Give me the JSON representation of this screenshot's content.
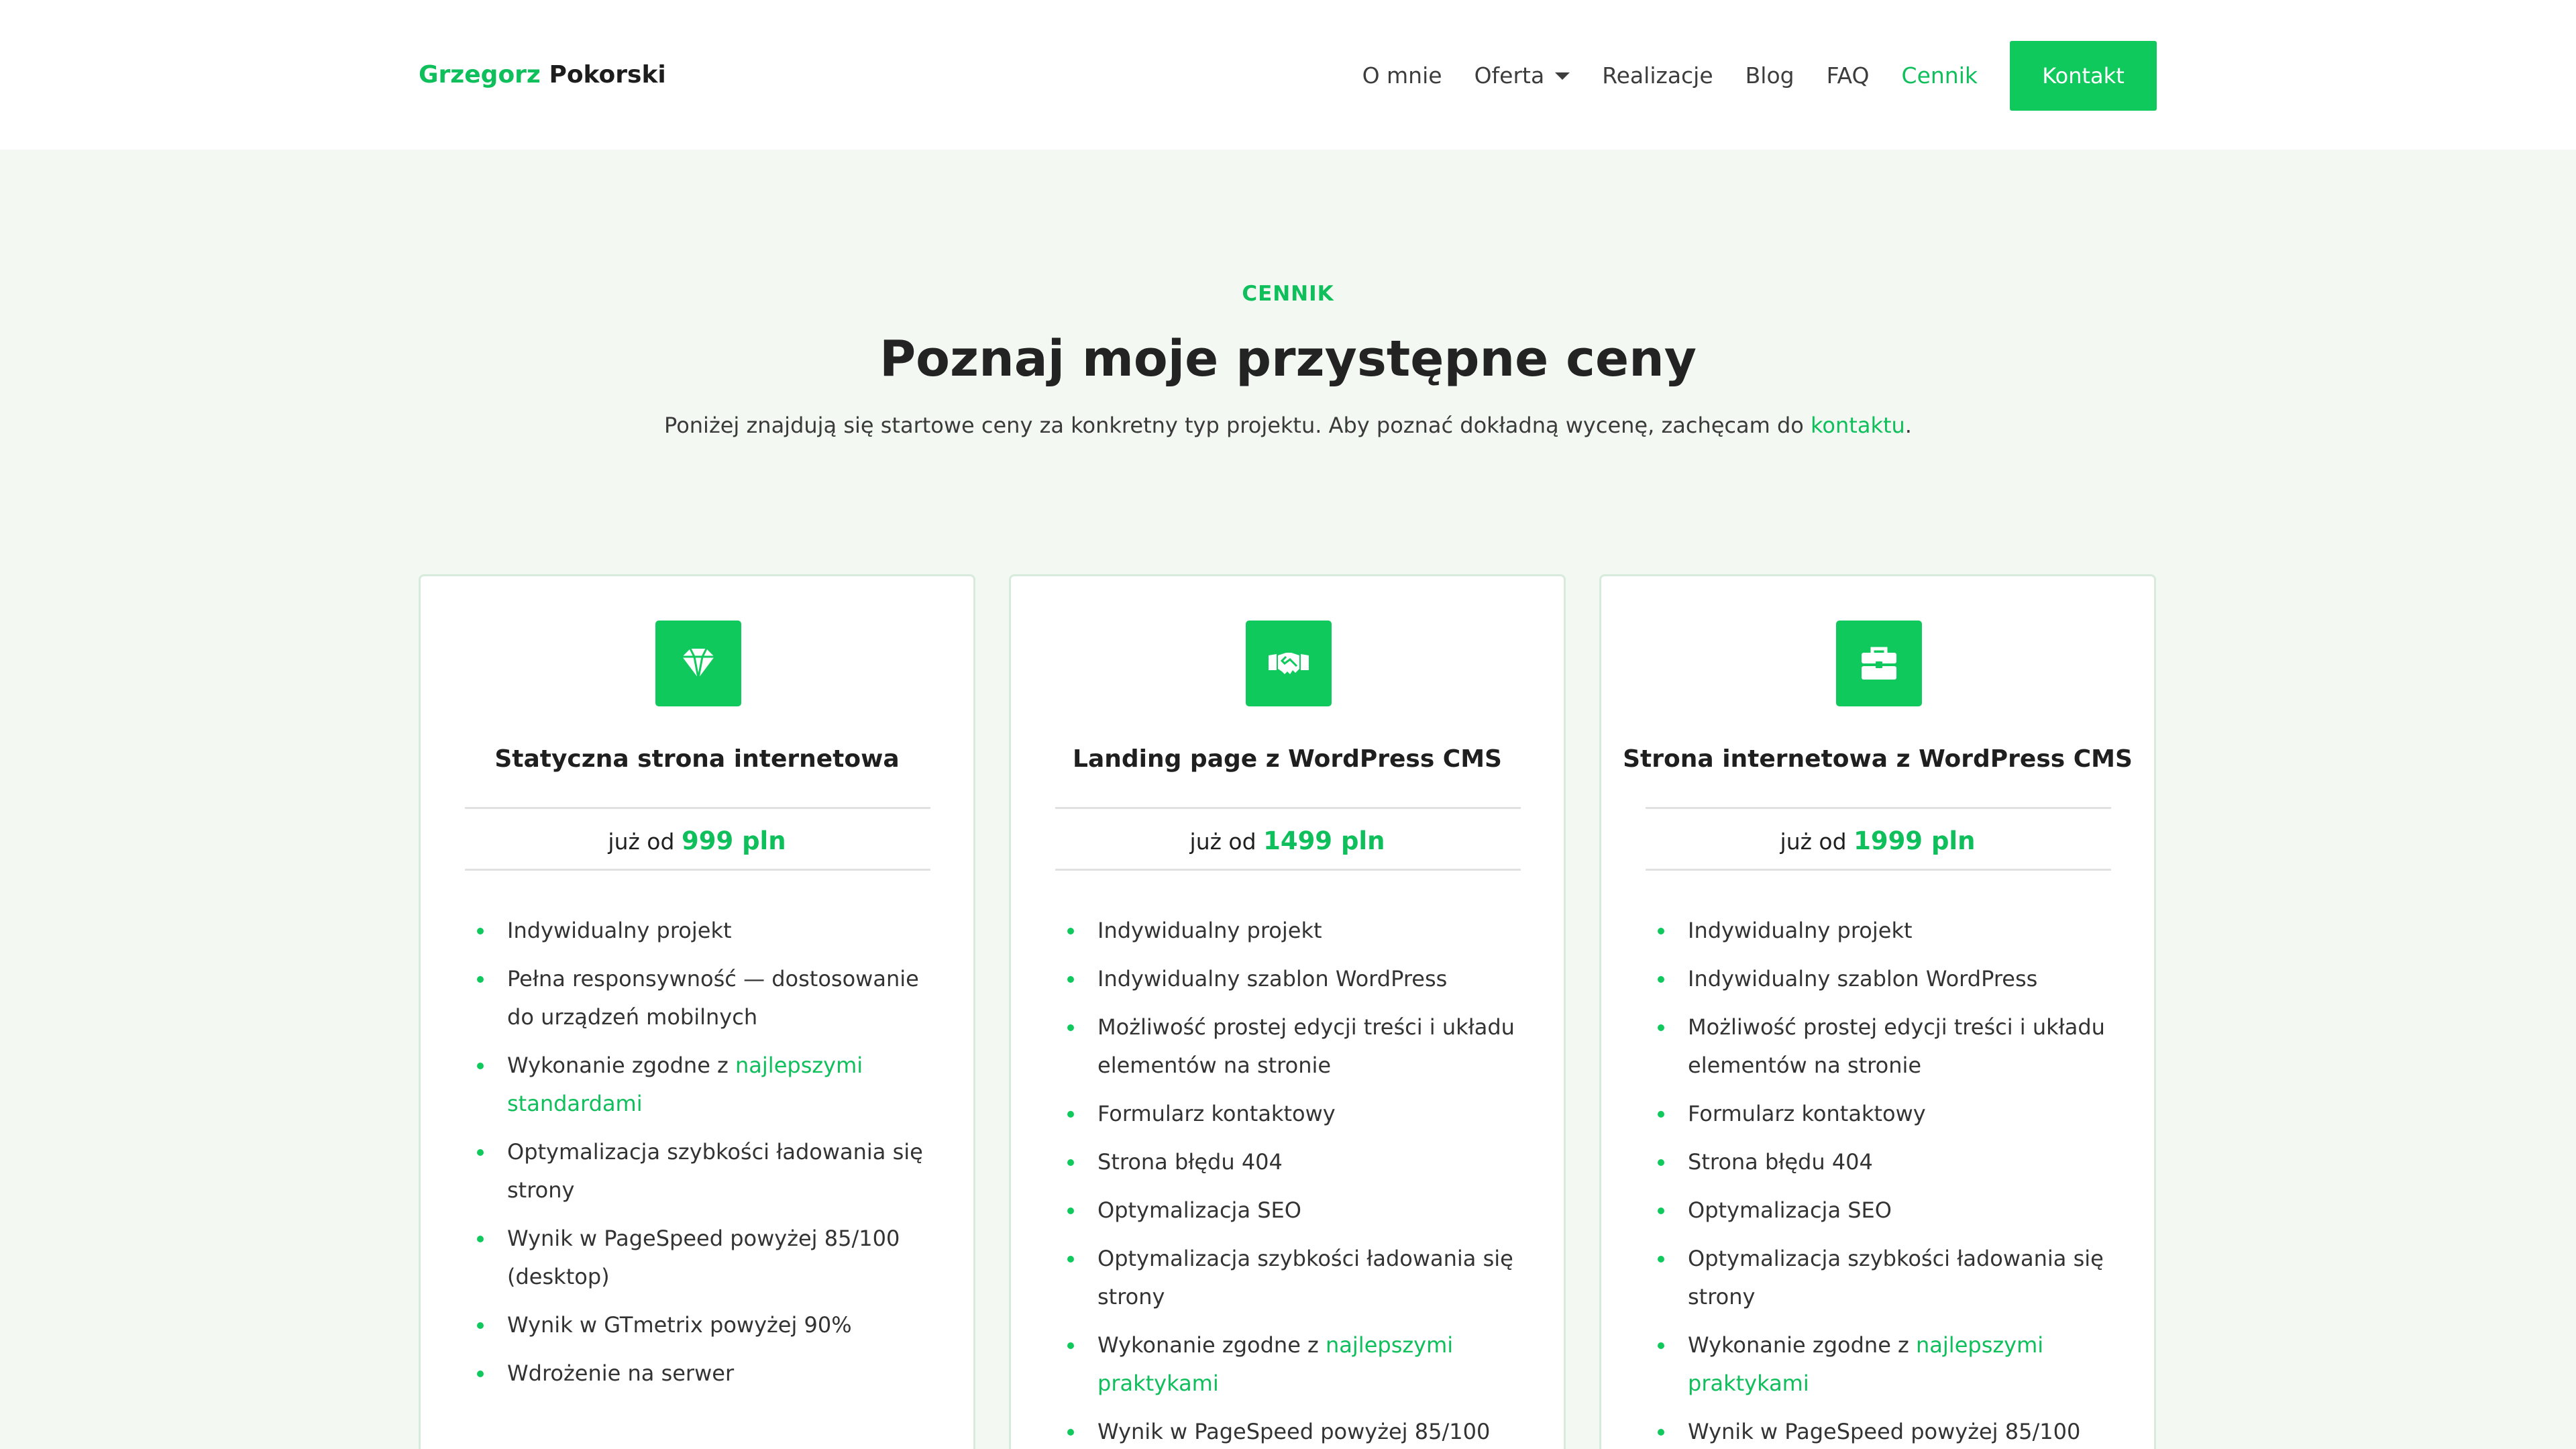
{
  "header": {
    "logo_first": "Grzegorz",
    "logo_last": "Pokorski",
    "nav": [
      {
        "label": "O mnie"
      },
      {
        "label": "Oferta"
      },
      {
        "label": "Realizacje"
      },
      {
        "label": "Blog"
      },
      {
        "label": "FAQ"
      },
      {
        "label": "Cennik"
      }
    ],
    "cta_label": "Kontakt"
  },
  "hero": {
    "kicker": "CENNIK",
    "title": "Poznaj moje przystępne ceny",
    "subtitle_before": "Poniżej znajdują się startowe ceny za konkretny typ projektu. Aby poznać dokładną wycenę, zachęcam do ",
    "subtitle_link": "kontaktu",
    "subtitle_after": "."
  },
  "colors": {
    "accent": "#10c95c",
    "background": "#f3f8f3"
  },
  "cards": [
    {
      "icon": "gem-icon",
      "title": "Statyczna strona internetowa",
      "price_prefix": "już od",
      "price": "999 pln",
      "features": [
        {
          "text": "Indywidualny projekt"
        },
        {
          "text": "Pełna responsywność — dostosowanie do urządzeń mobilnych"
        },
        {
          "text": "Wykonanie zgodne z ",
          "link": "najlepszymi standardami"
        },
        {
          "text": "Optymalizacja szybkości ładowania się strony"
        },
        {
          "text": "Wynik w PageSpeed powyżej 85/100 (desktop)"
        },
        {
          "text": "Wynik w GTmetrix powyżej 90%"
        },
        {
          "text": "Wdrożenie na serwer"
        }
      ]
    },
    {
      "icon": "handshake-icon",
      "title": "Landing page z WordPress CMS",
      "price_prefix": "już od",
      "price": "1499 pln",
      "features": [
        {
          "text": "Indywidualny projekt"
        },
        {
          "text": "Indywidualny szablon WordPress"
        },
        {
          "text": "Możliwość prostej edycji treści i układu elementów na stronie"
        },
        {
          "text": "Formularz kontaktowy"
        },
        {
          "text": "Strona błędu 404"
        },
        {
          "text": "Optymalizacja SEO"
        },
        {
          "text": "Optymalizacja szybkości ładowania się strony"
        },
        {
          "text": "Wykonanie zgodne z ",
          "link": "najlepszymi praktykami"
        },
        {
          "text": "Wynik w PageSpeed powyżej 85/100"
        }
      ]
    },
    {
      "icon": "briefcase-icon",
      "title": "Strona internetowa z WordPress CMS",
      "price_prefix": "już od",
      "price": "1999 pln",
      "features": [
        {
          "text": "Indywidualny projekt"
        },
        {
          "text": "Indywidualny szablon WordPress"
        },
        {
          "text": "Możliwość prostej edycji treści i układu elementów na stronie"
        },
        {
          "text": "Formularz kontaktowy"
        },
        {
          "text": "Strona błędu 404"
        },
        {
          "text": "Optymalizacja SEO"
        },
        {
          "text": "Optymalizacja szybkości ładowania się strony"
        },
        {
          "text": "Wykonanie zgodne z ",
          "link": "najlepszymi praktykami"
        },
        {
          "text": "Wynik w PageSpeed powyżej 85/100"
        }
      ]
    }
  ]
}
